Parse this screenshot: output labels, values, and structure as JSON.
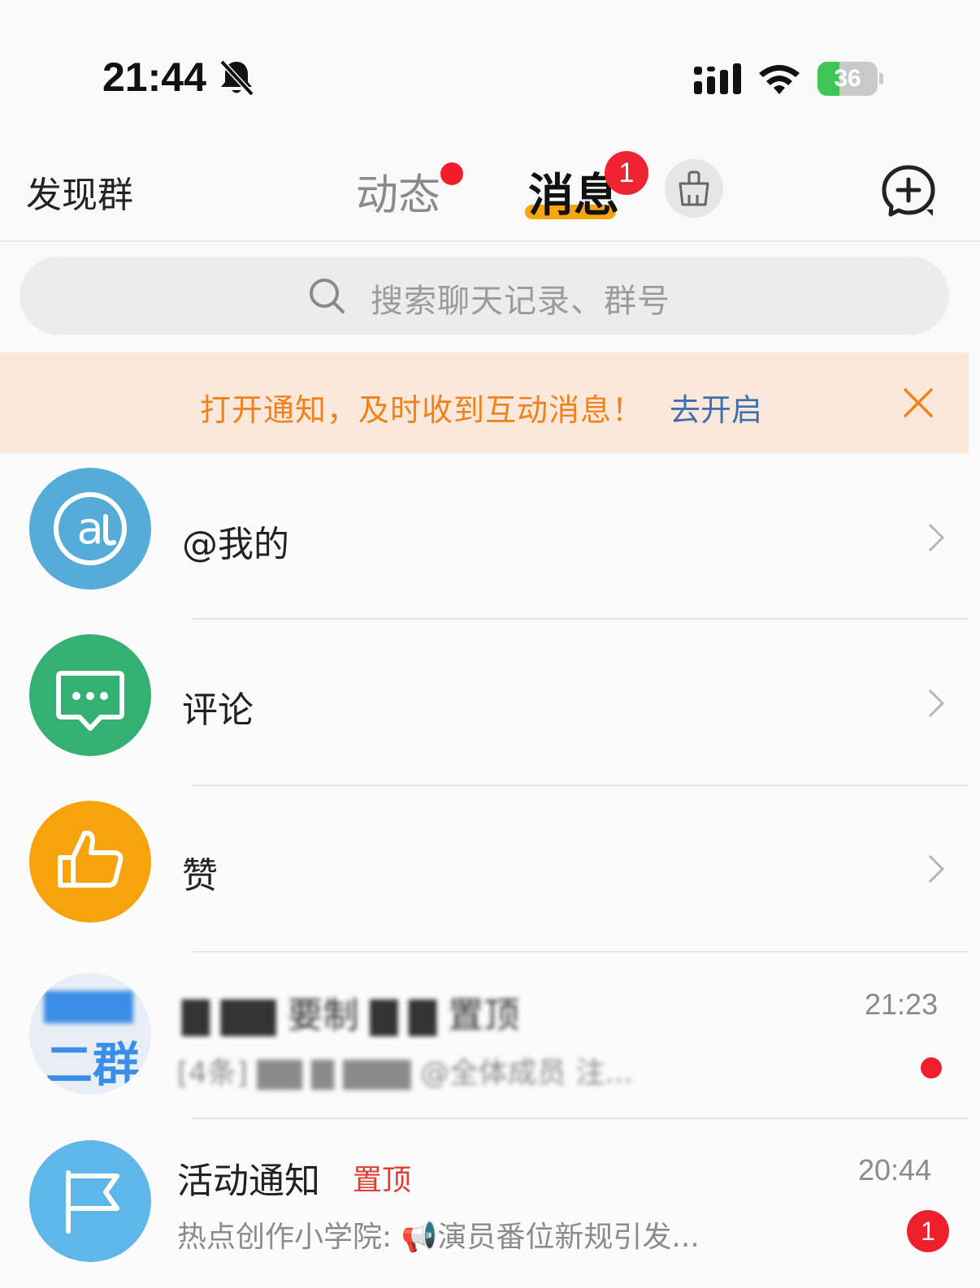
{
  "status_bar": {
    "time": "21:44",
    "battery_level": 36,
    "battery_text": "36"
  },
  "header": {
    "left_label": "发现群",
    "tabs": [
      {
        "label": "动态",
        "has_dot": true
      },
      {
        "label": "消息",
        "badge": "1",
        "active": true
      }
    ],
    "accent_color": "#f7a60f"
  },
  "search": {
    "placeholder": "搜索聊天记录、群号"
  },
  "notice": {
    "text": "打开通知，及时收到互动消息！",
    "link": "去开启"
  },
  "menu_items": [
    {
      "label": "@我的",
      "icon": "at-icon",
      "color": "#55acd9"
    },
    {
      "label": "评论",
      "icon": "comment-icon",
      "color": "#34b072"
    },
    {
      "label": "赞",
      "icon": "thumbs-up-icon",
      "color": "#f7a30c"
    }
  ],
  "conversations": [
    {
      "title": "▇ ▇▇ 要制 ▇ ▇ 置顶",
      "preview": "[4条]  ▇▇  ▇ ▇▇▇   @全体成员 注...",
      "time": "21:23",
      "unread_dot": true,
      "avatar_text": "二群"
    },
    {
      "title": "活动通知",
      "pin_label": "置顶",
      "preview": "热点创作小学院: 📢演员番位新规引发...",
      "time": "20:44",
      "unread_count": "1",
      "icon": "flag-icon"
    }
  ]
}
